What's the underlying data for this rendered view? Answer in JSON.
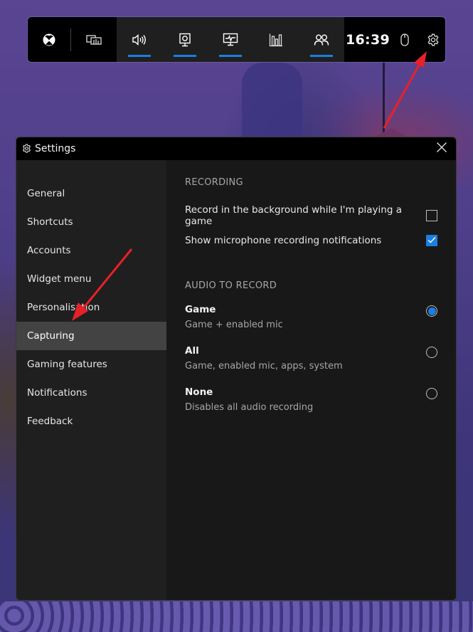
{
  "game_bar": {
    "time": "16:39",
    "buttons": [
      {
        "name": "xbox-icon",
        "active": false
      },
      {
        "name": "performance-overlay-icon",
        "active": false
      },
      {
        "name": "audio-icon",
        "active": true
      },
      {
        "name": "capture-icon",
        "active": true
      },
      {
        "name": "performance-icon",
        "active": true
      },
      {
        "name": "resources-icon",
        "active": false
      },
      {
        "name": "xbox-social-icon",
        "active": true
      },
      {
        "name": "mouse-icon",
        "active": false
      },
      {
        "name": "gear-icon",
        "active": false
      }
    ],
    "accent_color": "#1a7fe0"
  },
  "settings": {
    "title": "Settings",
    "nav": [
      {
        "label": "General",
        "active": false
      },
      {
        "label": "Shortcuts",
        "active": false
      },
      {
        "label": "Accounts",
        "active": false
      },
      {
        "label": "Widget menu",
        "active": false
      },
      {
        "label": "Personalisation",
        "active": false
      },
      {
        "label": "Capturing",
        "active": true
      },
      {
        "label": "Gaming features",
        "active": false
      },
      {
        "label": "Notifications",
        "active": false
      },
      {
        "label": "Feedback",
        "active": false
      }
    ],
    "recording": {
      "title": "RECORDING",
      "options": [
        {
          "label": "Record in the background while I'm playing a game",
          "checked": false
        },
        {
          "label": "Show microphone recording notifications",
          "checked": true
        }
      ]
    },
    "audio": {
      "title": "AUDIO TO RECORD",
      "selected": "Game",
      "options": [
        {
          "label": "Game",
          "description": "Game + enabled mic",
          "selected": true
        },
        {
          "label": "All",
          "description": "Game, enabled mic, apps, system",
          "selected": false
        },
        {
          "label": "None",
          "description": "Disables all audio recording",
          "selected": false
        }
      ]
    }
  },
  "annotations": {
    "arrow_color": "#e8202a",
    "arrows": [
      {
        "points_to": "gear-button"
      },
      {
        "points_to": "nav-capturing"
      }
    ]
  }
}
